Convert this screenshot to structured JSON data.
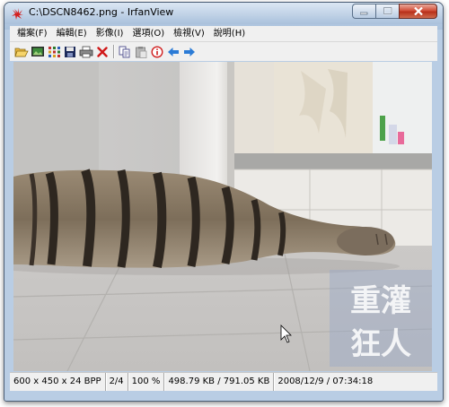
{
  "window": {
    "title": "C:\\DSCN8462.png - IrfanView"
  },
  "menu": {
    "items": [
      {
        "label": "檔案(F)"
      },
      {
        "label": "編輯(E)"
      },
      {
        "label": "影像(I)"
      },
      {
        "label": "選項(O)"
      },
      {
        "label": "檢視(V)"
      },
      {
        "label": "說明(H)"
      }
    ]
  },
  "toolbar": {
    "buttons": [
      "open-icon",
      "slideshow-icon",
      "thumbnails-icon",
      "save-icon",
      "print-icon",
      "delete-icon",
      "copy-icon",
      "paste-icon",
      "info-icon",
      "previous-icon",
      "next-icon"
    ]
  },
  "image": {
    "watermark_line1": "重灌",
    "watermark_line2": "狂人"
  },
  "status": {
    "dimensions": "600 x 450 x 24 BPP",
    "index": "2/4",
    "zoom": "100 %",
    "filesize": "498.79 KB / 791.05 KB",
    "datetime": "2008/12/9 / 07:34:18"
  },
  "colors": {
    "title_gradient_top": "#dbe7f4",
    "close_button": "#c94530",
    "arrow_blue": "#2b7bd6"
  }
}
